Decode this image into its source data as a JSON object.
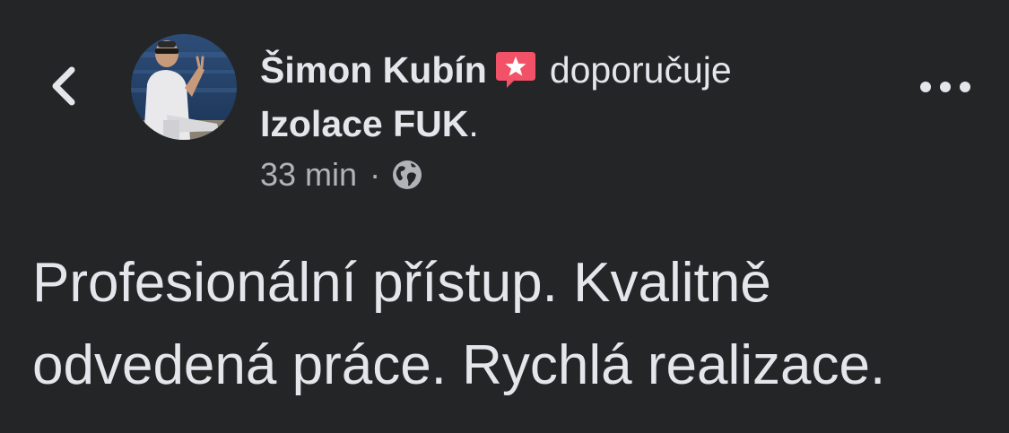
{
  "header": {
    "author_name": "Šimon Kubín",
    "verb": "doporučuje",
    "page_name": "Izolace FUK",
    "page_name_suffix": ".",
    "time": "33 min",
    "separator": "·",
    "privacy_icon": "globe-icon",
    "badge_icon": "recommend-star-badge-icon",
    "badge_color": "#f25268",
    "back_icon": "chevron-left-icon",
    "more_icon": "more-horizontal-icon"
  },
  "post": {
    "text_line1": "Profesionální přístup. Kvalitně",
    "text_line2": "odvedená práce. Rychlá realizace."
  },
  "colors": {
    "background": "#242526",
    "primary_text": "#e4e6eb",
    "secondary_text": "#b0b3b8"
  }
}
